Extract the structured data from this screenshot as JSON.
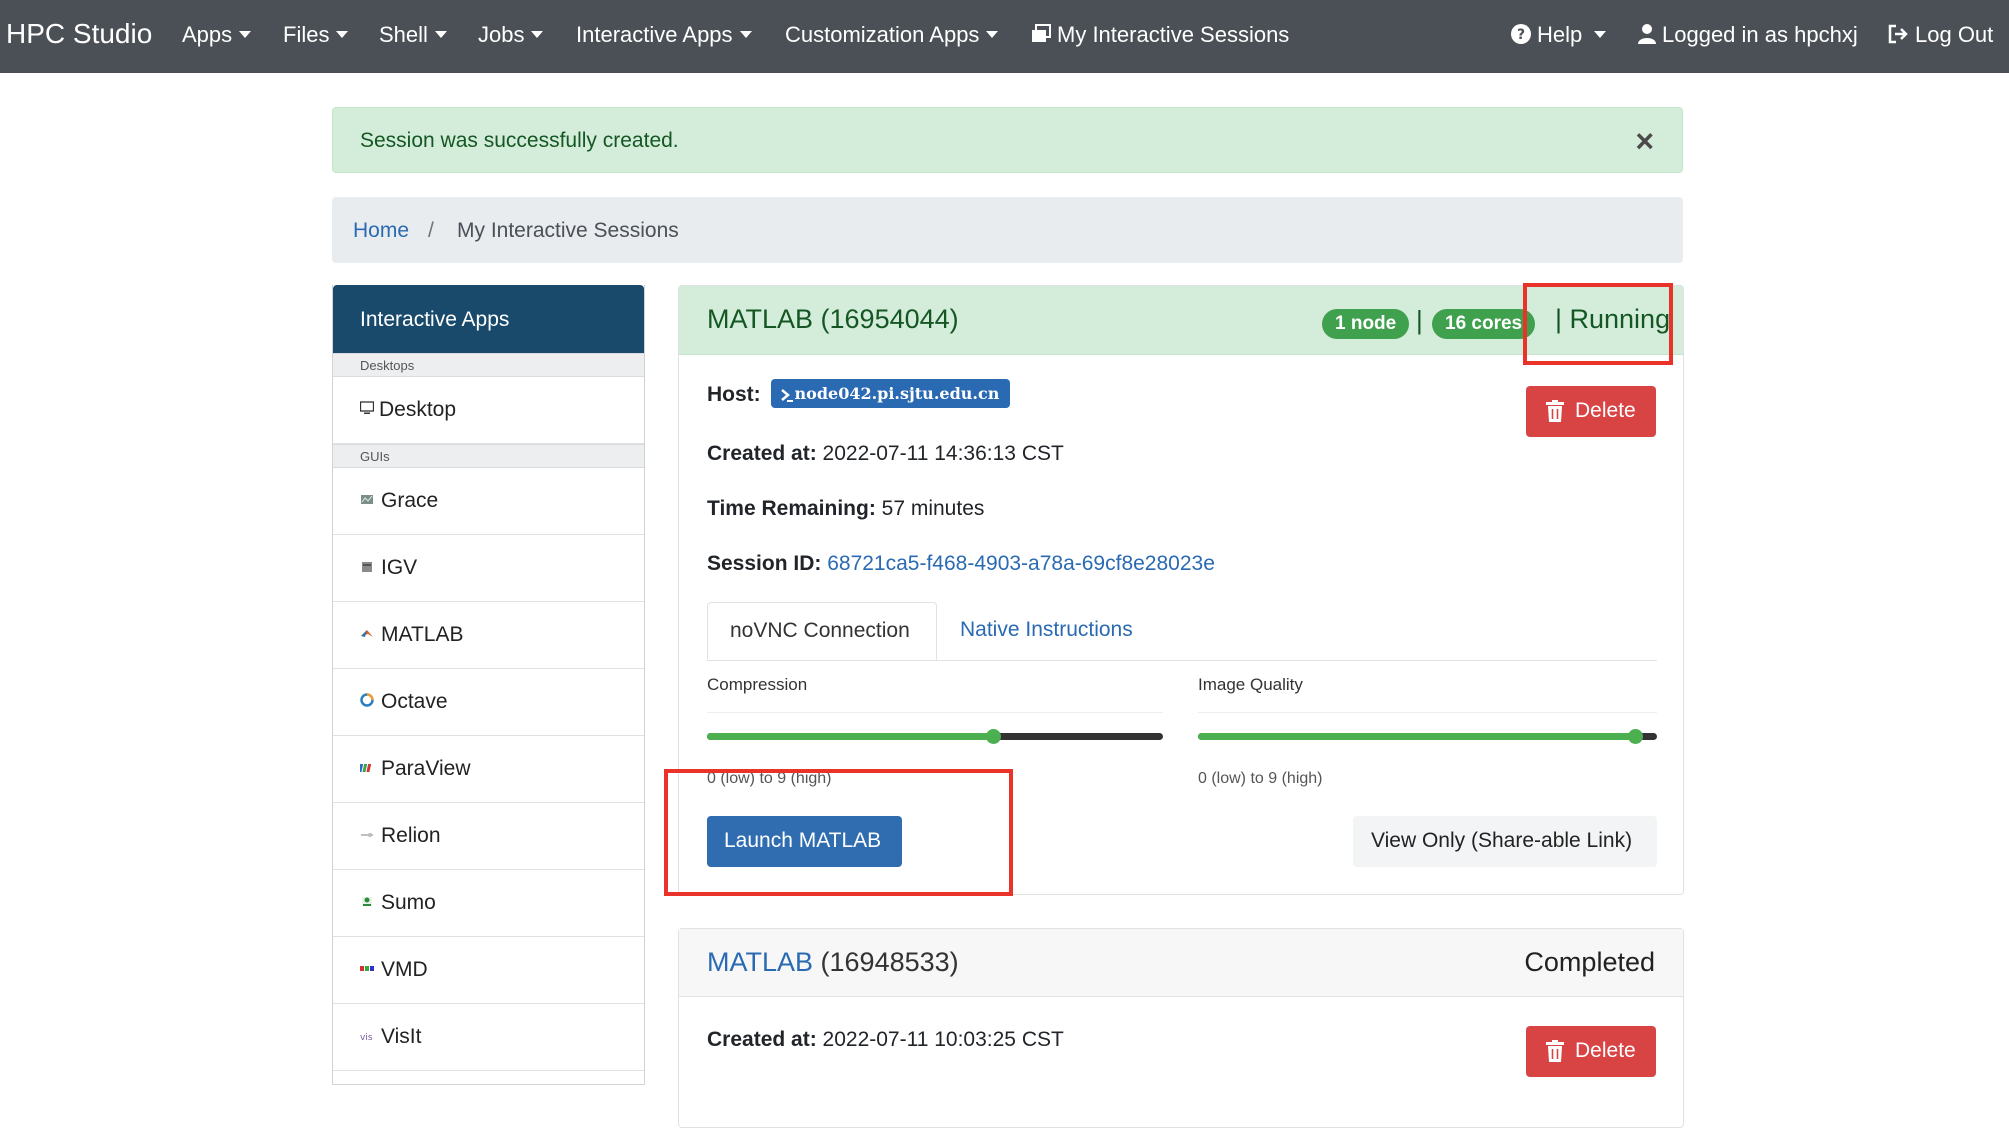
{
  "navbar": {
    "brand": "HPC Studio",
    "items": [
      {
        "label": "Apps"
      },
      {
        "label": "Files"
      },
      {
        "label": "Shell"
      },
      {
        "label": "Jobs"
      },
      {
        "label": "Interactive Apps"
      },
      {
        "label": "Customization Apps"
      }
    ],
    "sessions_label": "My Interactive Sessions",
    "help_label": "Help",
    "logged_in_label": "Logged in as hpchxj",
    "logout_label": "Log Out"
  },
  "alert": {
    "message": "Session was successfully created.",
    "close": "×"
  },
  "breadcrumb": {
    "home": "Home",
    "separator": "/",
    "current": "My Interactive Sessions"
  },
  "sidebar": {
    "title": "Interactive Apps",
    "categories": [
      "Desktops",
      "GUIs"
    ],
    "items": [
      {
        "label": "Desktop",
        "icon": "monitor-icon"
      },
      {
        "label": "Grace",
        "icon": "grace-icon"
      },
      {
        "label": "IGV",
        "icon": "igv-icon"
      },
      {
        "label": "MATLAB",
        "icon": "matlab-icon"
      },
      {
        "label": "Octave",
        "icon": "octave-icon"
      },
      {
        "label": "ParaView",
        "icon": "paraview-icon"
      },
      {
        "label": "Relion",
        "icon": "relion-icon"
      },
      {
        "label": "Sumo",
        "icon": "sumo-icon"
      },
      {
        "label": "VMD",
        "icon": "vmd-icon"
      },
      {
        "label": "VisIt",
        "icon": "visit-icon"
      }
    ]
  },
  "session": {
    "title": "MATLAB (16954044)",
    "nodes_badge": "1 node",
    "cores_badge": "16 cores",
    "separator": "|",
    "status": "| Running",
    "host_label": "Host:",
    "host_value": "node042.pi.sjtu.edu.cn",
    "created_label": "Created at:",
    "created_value": "2022-07-11 14:36:13 CST",
    "remaining_label": "Time Remaining:",
    "remaining_value": "57 minutes",
    "session_id_label": "Session ID:",
    "session_id_value": "68721ca5-f468-4903-a78a-69cf8e28023e",
    "delete_label": "Delete",
    "tabs": [
      "noVNC Connection",
      "Native Instructions"
    ],
    "compression": {
      "label": "Compression",
      "value": 6,
      "min": 0,
      "max": 9,
      "hint": "0 (low) to 9 (high)"
    },
    "quality": {
      "label": "Image Quality",
      "value": 9,
      "min": 0,
      "max": 9,
      "hint": "0 (low) to 9 (high)"
    },
    "launch_label": "Launch MATLAB",
    "view_only_label": "View Only (Share-able Link)"
  },
  "session2": {
    "app": "MATLAB",
    "job_id": " (16948533)",
    "status": "Completed",
    "created_label": "Created at:",
    "created_value": "2022-07-11 10:03:25 CST",
    "delete_label": "Delete"
  },
  "colors": {
    "navbar": "#4a5056",
    "success_bg": "#d4edda",
    "badge_green": "#3fa04d",
    "primary": "#2f6db0",
    "danger": "#d84343",
    "highlight": "#e8322a"
  }
}
